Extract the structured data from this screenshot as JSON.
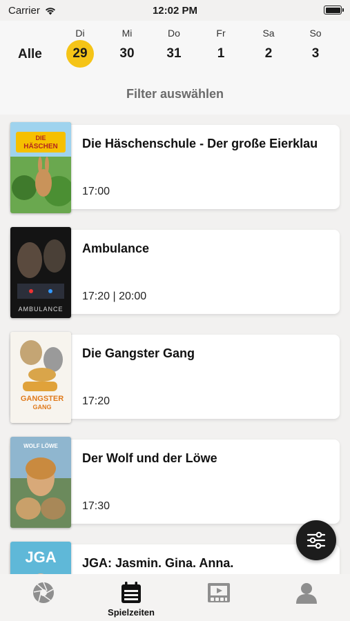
{
  "status_bar": {
    "carrier": "Carrier",
    "time": "12:02 PM",
    "battery_level": 1.0
  },
  "date_picker": {
    "all_label": "Alle",
    "days": [
      {
        "name": "Di",
        "number": "29",
        "selected": true
      },
      {
        "name": "Mi",
        "number": "30",
        "selected": false
      },
      {
        "name": "Do",
        "number": "31",
        "selected": false
      },
      {
        "name": "Fr",
        "number": "1",
        "selected": false
      },
      {
        "name": "Sa",
        "number": "2",
        "selected": false
      },
      {
        "name": "So",
        "number": "3",
        "selected": false
      }
    ],
    "accent_color": "#f5c417"
  },
  "filter": {
    "label": "Filter auswählen"
  },
  "movies": [
    {
      "title": "Die Häschenschule - Der große Eierklau",
      "times": "17:00",
      "poster_text": "DIE HÄSCHEN SCHULE"
    },
    {
      "title": "Ambulance",
      "times": "17:20  |  20:00",
      "poster_text": "AMBULANCE"
    },
    {
      "title": "Die Gangster Gang",
      "times": "17:20",
      "poster_text": "GANGSTER GANG"
    },
    {
      "title": "Der Wolf und der Löwe",
      "times": "17:30",
      "poster_text": "WOLF LÖWE"
    },
    {
      "title": "JGA: Jasmin. Gina. Anna.",
      "times": "",
      "poster_text": "JGA"
    }
  ],
  "tabbar": {
    "tabs": [
      {
        "label": "",
        "icon": "aperture-icon",
        "active": false
      },
      {
        "label": "Spielzeiten",
        "icon": "calendar-icon",
        "active": true
      },
      {
        "label": "",
        "icon": "cinema-icon",
        "active": false
      },
      {
        "label": "",
        "icon": "profile-icon",
        "active": false
      }
    ]
  }
}
